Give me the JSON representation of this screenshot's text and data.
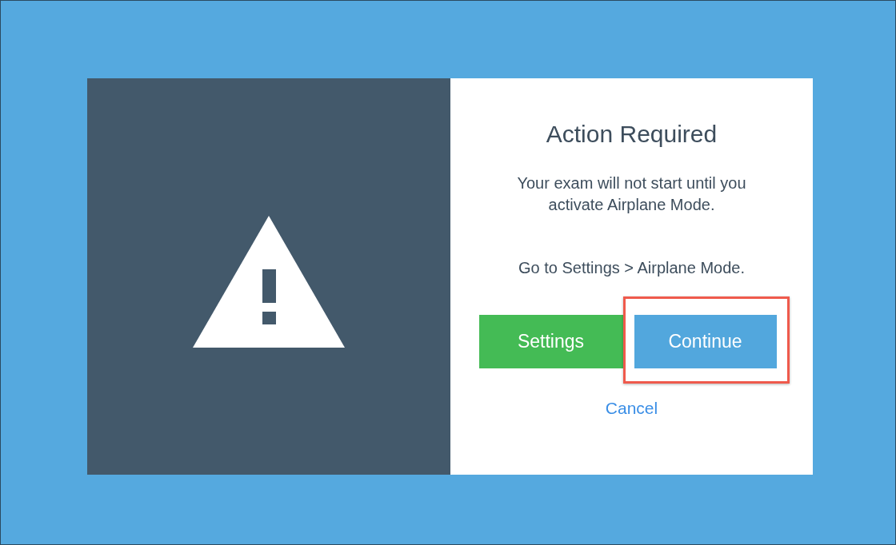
{
  "dialog": {
    "title": "Action Required",
    "messages": [
      "Your exam will not start until you activate Airplane Mode.",
      "Go to Settings > Airplane Mode."
    ],
    "buttons": [
      {
        "label": "Settings",
        "kind": "secondary",
        "highlighted": false
      },
      {
        "label": "Continue",
        "kind": "primary",
        "highlighted": true
      }
    ],
    "cancel_link": "Cancel"
  }
}
